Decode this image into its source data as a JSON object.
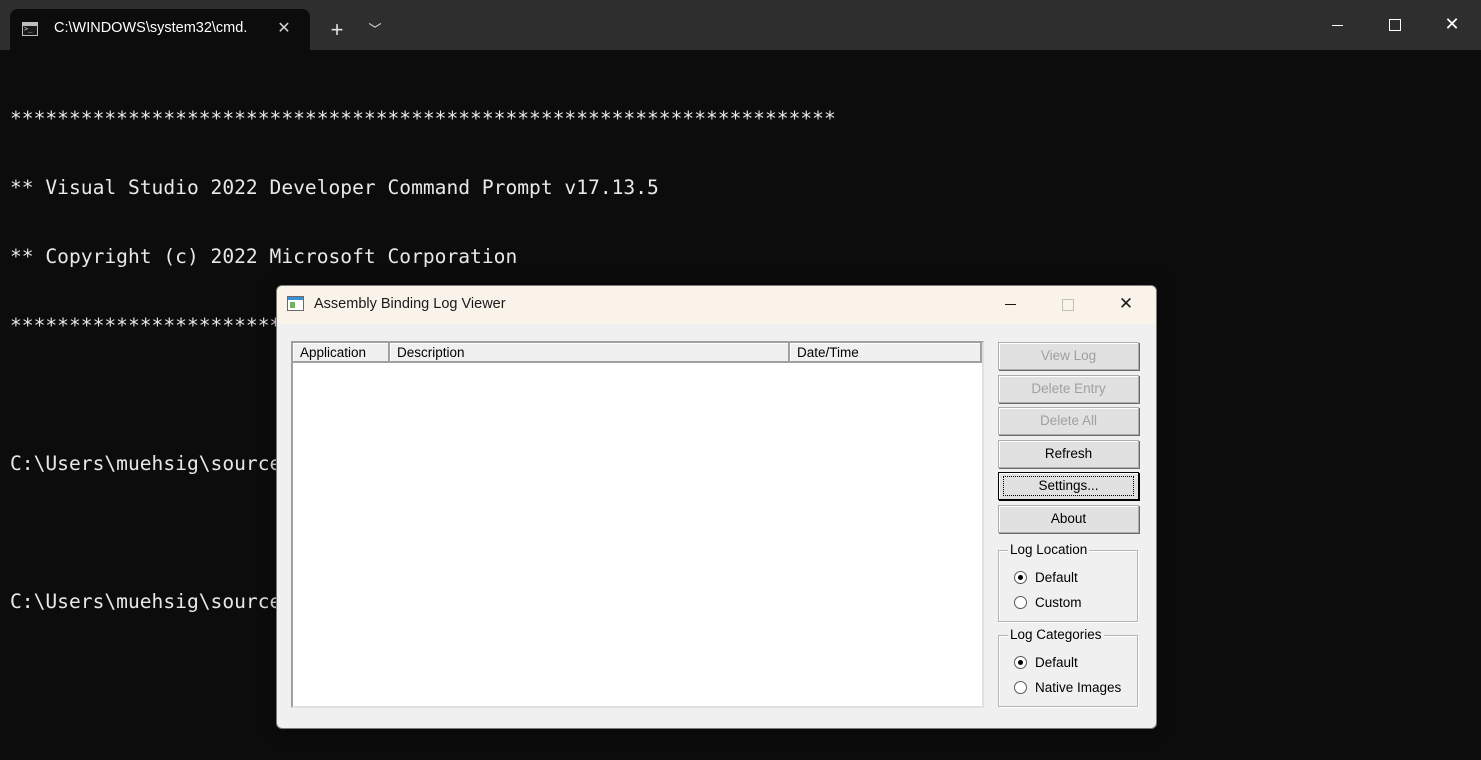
{
  "terminal": {
    "tab_title": "C:\\WINDOWS\\system32\\cmd.",
    "lines": [
      "**********************************************************************",
      "** Visual Studio 2022 Developer Command Prompt v17.13.5",
      "** Copyright (c) 2022 Microsoft Corporation",
      "**********************************************************************",
      "",
      "C:\\Users\\muehsig\\source\\repos\\WpfApp8>fuslogvw",
      "",
      "C:\\Users\\muehsig\\source\\repos\\WpfApp8>"
    ]
  },
  "dialog": {
    "title": "Assembly Binding Log Viewer",
    "columns": [
      "Application",
      "Description",
      "Date/Time"
    ],
    "buttons": {
      "view_log": "View Log",
      "delete_entry": "Delete Entry",
      "delete_all": "Delete All",
      "refresh": "Refresh",
      "settings": "Settings...",
      "about": "About"
    },
    "log_location": {
      "legend": "Log Location",
      "options": [
        "Default",
        "Custom"
      ],
      "selected": "Default"
    },
    "log_categories": {
      "legend": "Log Categories",
      "options": [
        "Default",
        "Native Images"
      ],
      "selected": "Default"
    }
  },
  "icons": {
    "terminal_tab": "terminal-icon",
    "close": "close-icon",
    "new_tab": "plus-icon",
    "dropdown": "chevron-down-icon",
    "minimize": "minimize-icon",
    "maximize": "maximize-icon",
    "app": "app-window-icon"
  }
}
